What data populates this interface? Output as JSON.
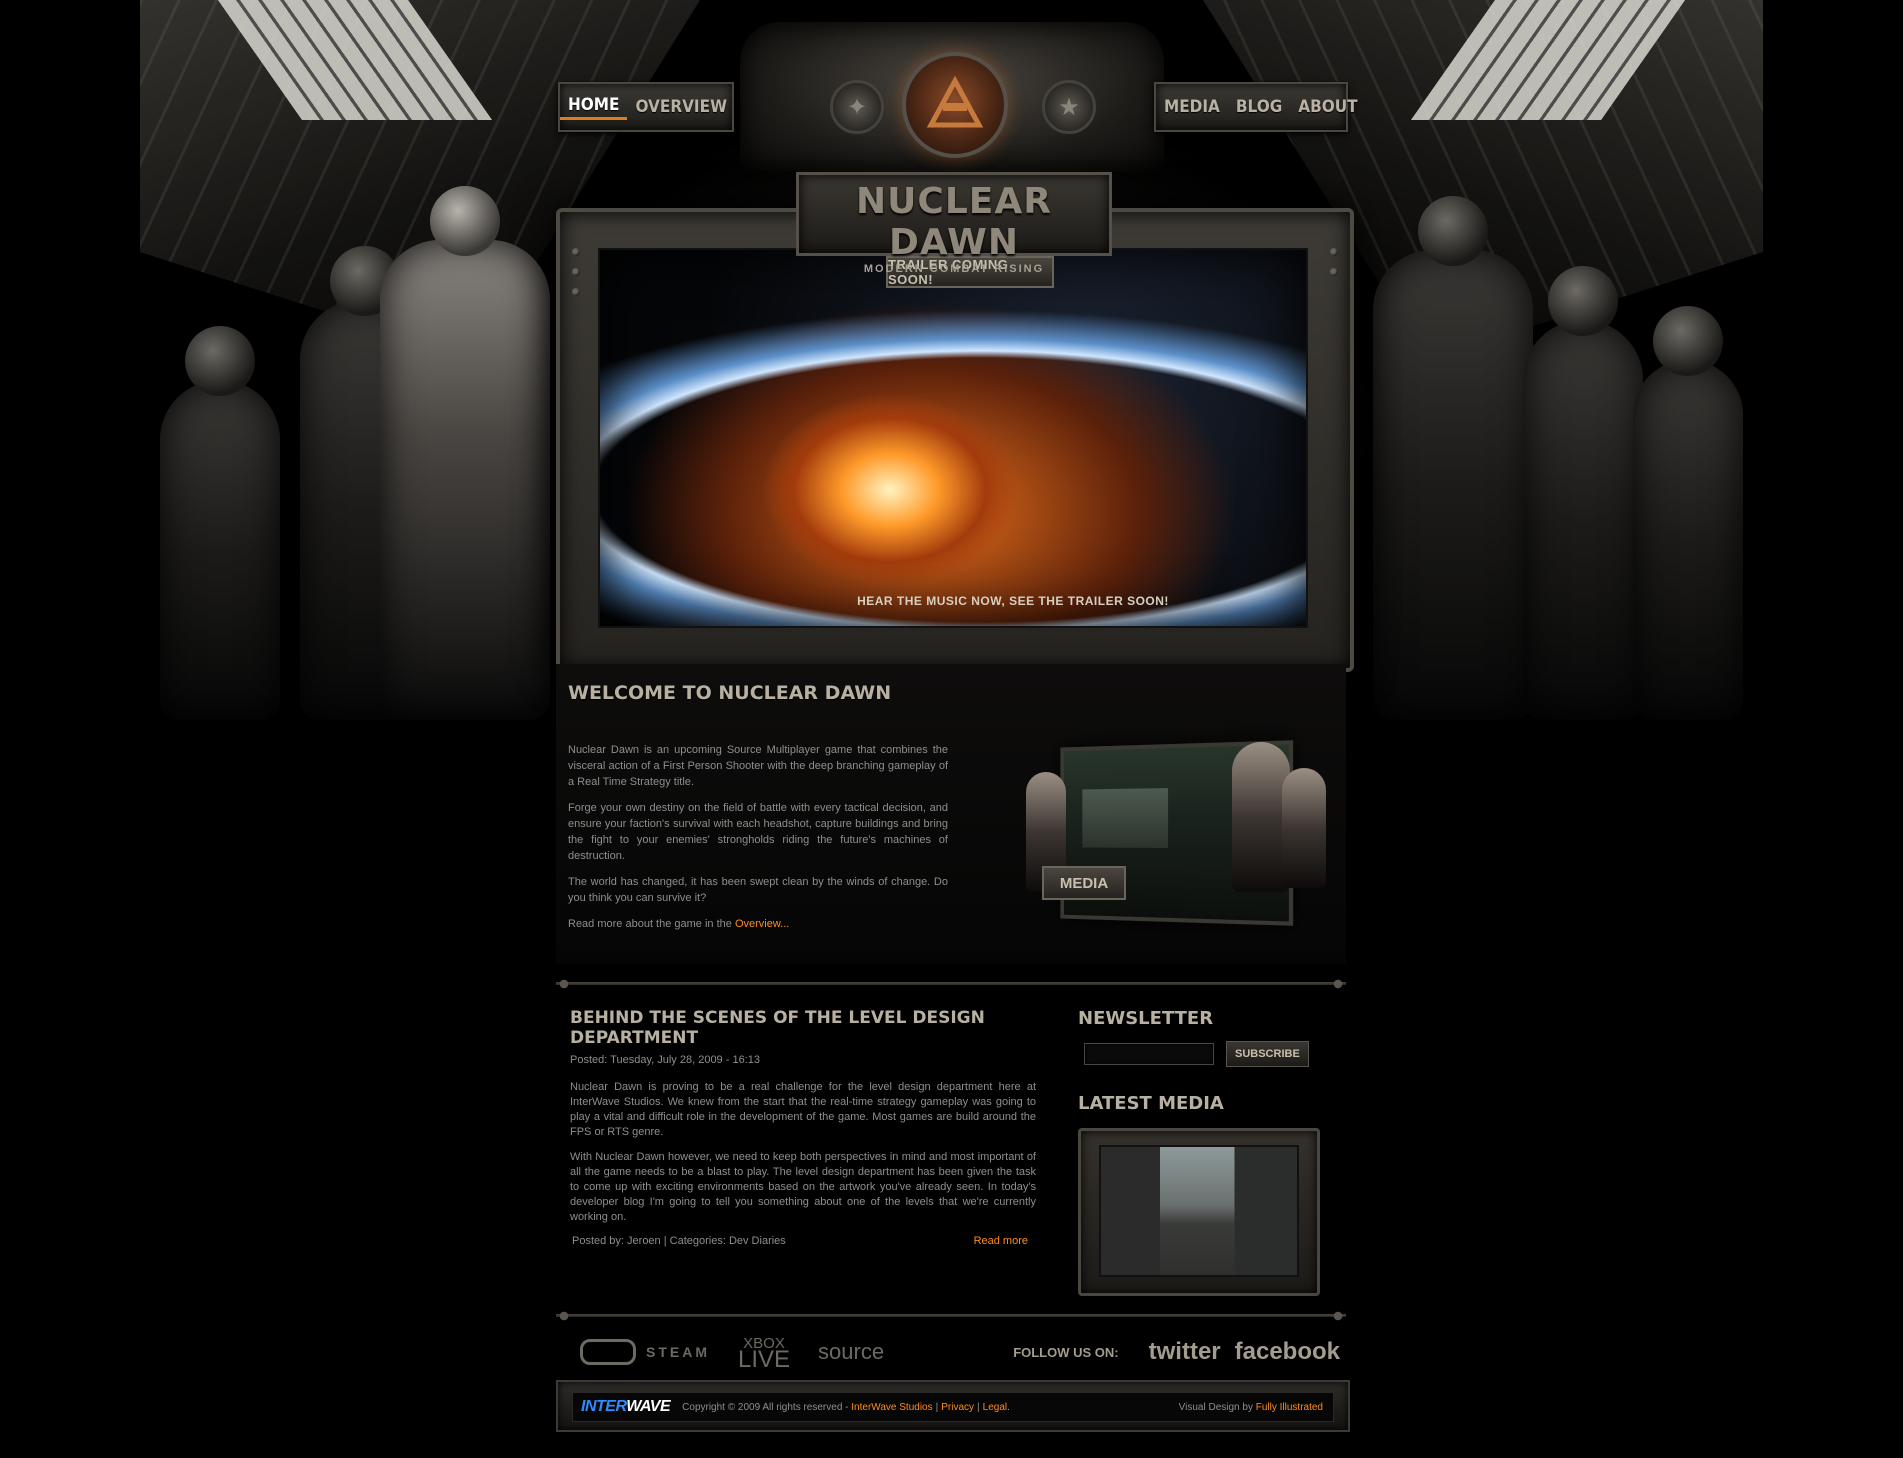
{
  "nav": {
    "left": [
      "HOME",
      "OVERVIEW"
    ],
    "right": [
      "MEDIA",
      "BLOG",
      "ABOUT"
    ],
    "active": "HOME"
  },
  "logo": {
    "title": "NUCLEAR DAWN",
    "subtitle": "MODERN COMBAT RISING"
  },
  "hero": {
    "badge": "TRAILER COMING SOON!",
    "caption": "HEAR THE MUSIC NOW, SEE THE TRAILER SOON!"
  },
  "welcome": {
    "heading": "WELCOME TO NUCLEAR DAWN",
    "paragraphs": [
      "Nuclear Dawn is an upcoming Source Multiplayer game that combines the visceral action of a First Person Shooter with the deep branching gameplay of a Real Time Strategy title.",
      "Forge your own destiny on the field of battle with every tactical decision, and ensure your faction's survival with each headshot, capture buildings and bring the fight to your enemies' strongholds riding the future's machines of destruction.",
      "The world has changed, it has been swept clean by the winds of change. Do you think you can survive it?"
    ],
    "readmore_prefix": "Read more about the game in the",
    "readmore_link": "Overview...",
    "media_label": "MEDIA"
  },
  "blog": {
    "title": "BEHIND THE SCENES OF THE LEVEL DESIGN DEPARTMENT",
    "posted": "Posted: Tuesday, July 28, 2009 - 16:13",
    "paragraphs": [
      "Nuclear Dawn is proving to be a real challenge for the level design department here at InterWave Studios. We knew from the start that the real-time strategy gameplay was going to play a vital and difficult role in the development of the game. Most games are build around the FPS or RTS genre.",
      "With Nuclear Dawn however, we need to keep both perspectives in mind and most important of all the game needs to be a blast to play. The level design department has been given the task to come up with exciting environments based on the artwork you've already seen. In today's developer blog I'm going to tell you something about one of the levels that we're currently working on."
    ],
    "meta": "Posted by: Jeroen | Categories: Dev Diaries",
    "readmore": "Read more"
  },
  "sidebar": {
    "newsletter_title": "NEWSLETTER",
    "subscribe_label": "SUBSCRIBE",
    "latest_media_title": "LATEST MEDIA"
  },
  "platforms": {
    "steam": "STEAM",
    "xbox_top": "XBOX",
    "xbox_bottom": "LIVE",
    "source": "source",
    "follow": "FOLLOW US ON:",
    "twitter": "twitter",
    "facebook": "facebook"
  },
  "footer": {
    "brand_a": "INTER",
    "brand_b": "WAVE",
    "copyright": "Copyright © 2009 All rights reserved -",
    "studios": "InterWave Studios",
    "privacy": "Privacy",
    "legal": "Legal",
    "design_prefix": "Visual Design by",
    "design_link": "Fully Illustrated"
  },
  "colors": {
    "accent": "#ff8b1c",
    "brand_blue": "#2f8cff",
    "background": "#000000"
  }
}
